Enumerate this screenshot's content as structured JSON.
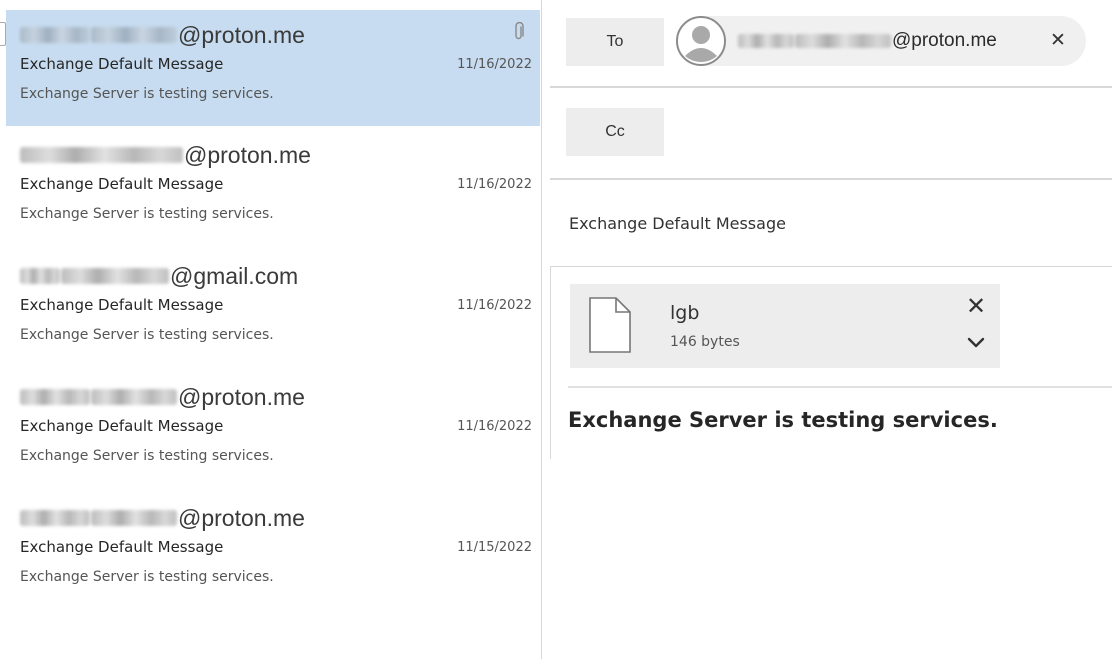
{
  "message_list": {
    "items": [
      {
        "sender_domain": "@proton.me",
        "subject": "Exchange Default Message",
        "preview": "Exchange Server is testing services.",
        "date": "11/16/2022",
        "selected": true,
        "has_attachment": true
      },
      {
        "sender_domain": "@proton.me",
        "subject": "Exchange Default Message",
        "preview": "Exchange Server is testing services.",
        "date": "11/16/2022",
        "selected": false,
        "has_attachment": false
      },
      {
        "sender_domain": "@gmail.com",
        "subject": "Exchange Default Message",
        "preview": "Exchange Server is testing services.",
        "date": "11/16/2022",
        "selected": false,
        "has_attachment": false
      },
      {
        "sender_domain": "@proton.me",
        "subject": "Exchange Default Message",
        "preview": "Exchange Server is testing services.",
        "date": "11/16/2022",
        "selected": false,
        "has_attachment": false
      },
      {
        "sender_domain": "@proton.me",
        "subject": "Exchange Default Message",
        "preview": "Exchange Server is testing services.",
        "date": "11/15/2022",
        "selected": false,
        "has_attachment": false
      }
    ]
  },
  "compose": {
    "to_label": "To",
    "cc_label": "Cc",
    "recipient": {
      "domain": "@proton.me",
      "remove_glyph": "✕",
      "icon": "avatar-placeholder-icon"
    },
    "subject": "Exchange Default Message",
    "attachment": {
      "name": "lgb",
      "size": "146 bytes",
      "remove_glyph": "✕",
      "icons": [
        "file-icon",
        "chevron-down-icon"
      ]
    },
    "body": "Exchange Server is testing services."
  },
  "colors": {
    "selected_row": "#c7dcf0",
    "button_bg": "#ededed",
    "chip_bg": "#f0f0f0",
    "divider": "#d8d8d8"
  }
}
